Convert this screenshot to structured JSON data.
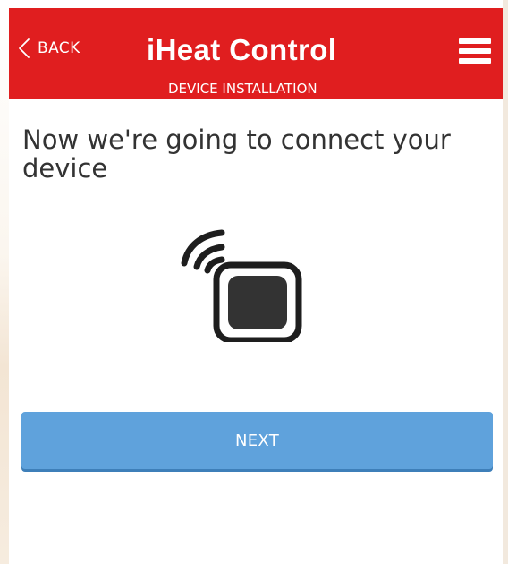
{
  "header": {
    "back_label": "BACK",
    "title": "iHeat Control",
    "subtitle": "DEVICE INSTALLATION",
    "color": "#e01e1f"
  },
  "main": {
    "heading": "Now we're going to connect your device",
    "illustration_icon": "wireless-thermostat-icon",
    "next_label": "NEXT",
    "next_color": "#5fa2dc"
  },
  "icons": {
    "back": "chevron-left-icon",
    "menu": "hamburger-menu-icon"
  }
}
